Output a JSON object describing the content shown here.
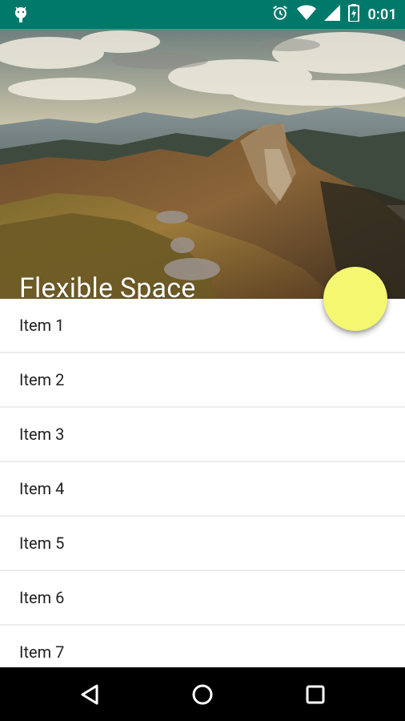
{
  "status_bar": {
    "time": "0:01",
    "icons": [
      "android-icon",
      "alarm-icon",
      "wifi-icon",
      "signal-icon",
      "battery-icon"
    ]
  },
  "header": {
    "title": "Flexible Space"
  },
  "list": {
    "items": [
      "Item 1",
      "Item 2",
      "Item 3",
      "Item 4",
      "Item 5",
      "Item 6",
      "Item 7"
    ]
  },
  "fab": {
    "color": "#f4f76f"
  },
  "nav": {
    "buttons": [
      "back-icon",
      "home-icon",
      "recents-icon"
    ]
  },
  "colors": {
    "status_bar": "#00796b",
    "fab": "#f4f76f"
  }
}
